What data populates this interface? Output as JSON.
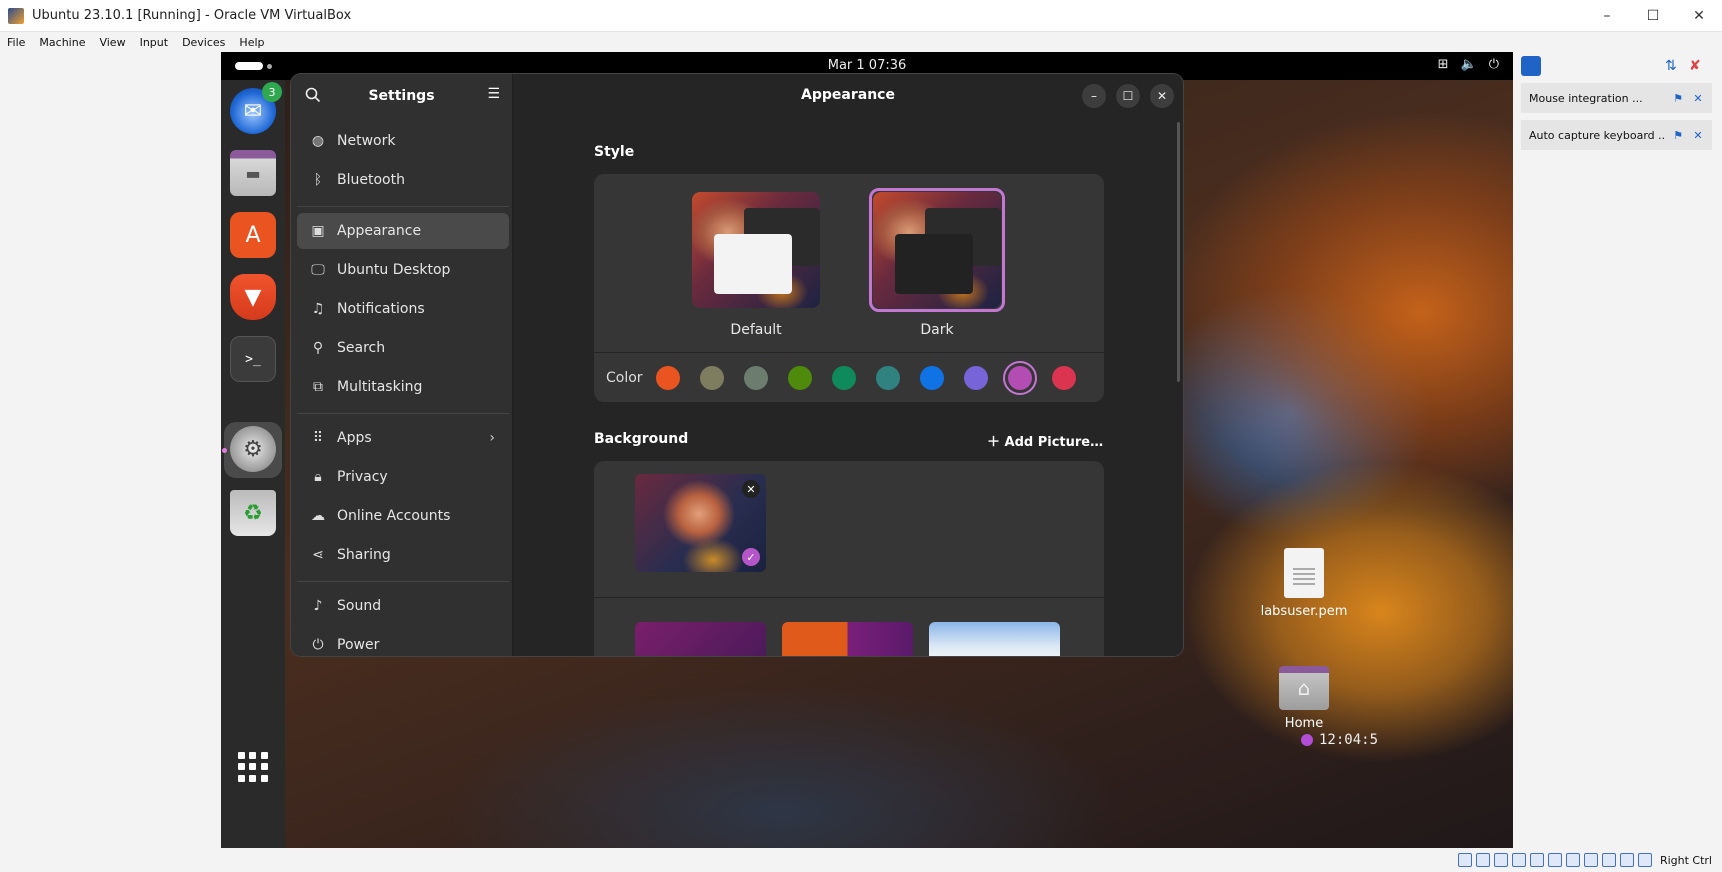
{
  "host": {
    "title": "Ubuntu 23.10.1 [Running] - Oracle VM VirtualBox",
    "menu": [
      "File",
      "Machine",
      "View",
      "Input",
      "Devices",
      "Help"
    ],
    "window_controls": [
      "–",
      "☐",
      "✕"
    ],
    "status_right": "Right Ctrl"
  },
  "vm_topbar": {
    "clock": "Mar 1  07:36",
    "tray": [
      "network-icon",
      "volume-icon",
      "power-icon"
    ]
  },
  "dock": {
    "thunderbird_badge": "3",
    "apps": [
      "thunderbird",
      "files",
      "app-center",
      "brave",
      "terminal",
      "settings",
      "trash"
    ]
  },
  "settings": {
    "sidebar_title": "Settings",
    "items": [
      {
        "label": "Network",
        "icon": "network-icon"
      },
      {
        "label": "Bluetooth",
        "icon": "bluetooth-icon"
      },
      {
        "label": "Appearance",
        "icon": "appearance-icon",
        "selected": true
      },
      {
        "label": "Ubuntu Desktop",
        "icon": "desktop-icon"
      },
      {
        "label": "Notifications",
        "icon": "bell-icon"
      },
      {
        "label": "Search",
        "icon": "search-icon"
      },
      {
        "label": "Multitasking",
        "icon": "multitasking-icon"
      },
      {
        "label": "Apps",
        "icon": "apps-icon",
        "chevron": "›"
      },
      {
        "label": "Privacy",
        "icon": "lock-icon"
      },
      {
        "label": "Online Accounts",
        "icon": "cloud-icon"
      },
      {
        "label": "Sharing",
        "icon": "share-icon"
      },
      {
        "label": "Sound",
        "icon": "music-icon"
      },
      {
        "label": "Power",
        "icon": "power-icon"
      }
    ],
    "page_title": "Appearance",
    "style_section": "Style",
    "style_options": [
      {
        "label": "Default",
        "selected": false
      },
      {
        "label": "Dark",
        "selected": true
      }
    ],
    "color_label": "Color",
    "colors": [
      "#e95420",
      "#7e7d5f",
      "#6c7d70",
      "#4e8a0b",
      "#0f8a5c",
      "#308280",
      "#0f73e6",
      "#7764d8",
      "#b34cb3",
      "#da3450"
    ],
    "selected_color": "#b34cb3",
    "background_section": "Background",
    "add_picture": "Add Picture…"
  },
  "desktop": {
    "icons": [
      {
        "label": "labsuser.pem"
      },
      {
        "label": "Home"
      }
    ],
    "mini_clock": "12:04:5"
  },
  "side_panel": {
    "notifications": [
      "Mouse integration ...",
      "Auto capture keyboard ..."
    ]
  }
}
